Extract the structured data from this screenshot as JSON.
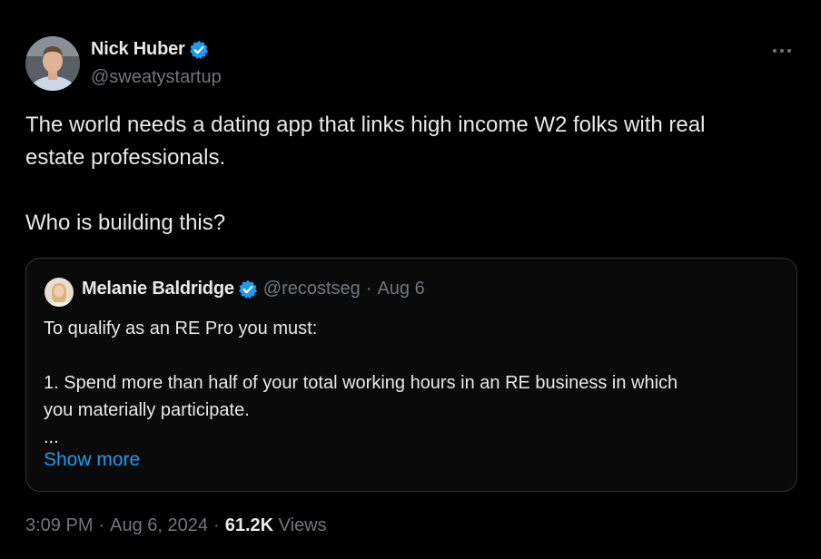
{
  "author": {
    "name": "Nick Huber",
    "handle": "@sweatystartup"
  },
  "tweet": {
    "lines": [
      "The world needs a dating app that links high income W2 folks with real",
      "estate professionals.",
      "Who is building this?"
    ]
  },
  "quoted": {
    "name": "Melanie Baldridge",
    "handle": "@recostseg",
    "separator": "·",
    "date": "Aug 6",
    "lines": [
      "To qualify as an RE Pro you must:",
      "1. Spend more than half of your total working hours in an RE business in which",
      "you materially participate.",
      "..."
    ],
    "show_more": "Show more"
  },
  "meta": {
    "time": "3:09 PM",
    "date": "Aug 6, 2024",
    "separator": "·",
    "views_count": "61.2K",
    "views_label": "Views"
  },
  "colors": {
    "background": "#000000",
    "text": "#e7e9ea",
    "muted": "#71767b",
    "accent": "#1d9bf0",
    "border": "#2f3336"
  },
  "icons": {
    "verified": "verified-badge-icon",
    "more": "more-options-icon"
  }
}
